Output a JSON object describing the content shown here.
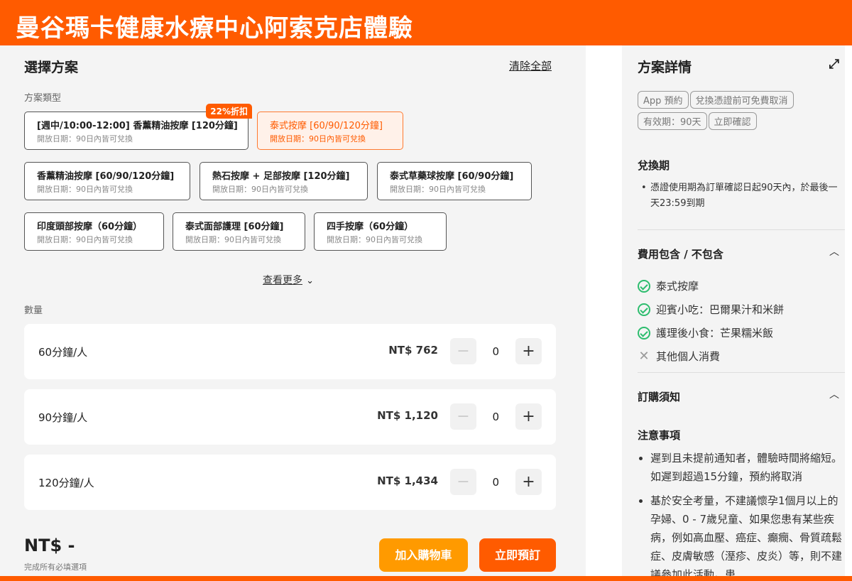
{
  "header": {
    "title": "曼谷瑪卡健康水療中心阿索克店體驗"
  },
  "select": {
    "title": "選擇方案",
    "clear_all": "清除全部",
    "type_label": "方案類型",
    "see_more": "查看更多",
    "qty_label": "數量"
  },
  "packages": [
    {
      "name": "[週中/10:00-12:00] 香薰精油按摩 [120分鐘]",
      "sub": "開放日期：90日內皆可兌換",
      "badge": "22%折扣",
      "selected": false
    },
    {
      "name": "泰式按摩 [60/90/120分鐘]",
      "sub": "開放日期：90日內皆可兌換",
      "selected": true
    },
    {
      "name": "香薰精油按摩 [60/90/120分鐘]",
      "sub": "開放日期：90日內皆可兌換",
      "selected": false
    },
    {
      "name": "熱石按摩 + 足部按摩 [120分鐘]",
      "sub": "開放日期：90日內皆可兌換",
      "selected": false
    },
    {
      "name": "泰式草藥球按摩 [60/90分鐘]",
      "sub": "開放日期：90日內皆可兌換",
      "selected": false
    },
    {
      "name": "印度頭部按摩（60分鐘）",
      "sub": "開放日期：90日內皆可兌換",
      "selected": false
    },
    {
      "name": "泰式面部護理 [60分鐘]",
      "sub": "開放日期：90日內皆可兌換",
      "selected": false
    },
    {
      "name": "四手按摩（60分鐘）",
      "sub": "開放日期：90日內皆可兌換",
      "selected": false
    }
  ],
  "quantities": [
    {
      "name": "60分鐘/人",
      "price": "NT$ 762",
      "value": "0"
    },
    {
      "name": "90分鐘/人",
      "price": "NT$ 1,120",
      "value": "0"
    },
    {
      "name": "120分鐘/人",
      "price": "NT$ 1,434",
      "value": "0"
    }
  ],
  "footer": {
    "total": "NT$ -",
    "hint": "完成所有必填選項",
    "add_to_cart": "加入購物車",
    "book_now": "立即預訂"
  },
  "details": {
    "title": "方案詳情",
    "tags": [
      "App 預約",
      "兌換憑證前可免費取消",
      "有效期：90天",
      "立即確認"
    ],
    "redeem_title": "兌換期",
    "redeem_text": "憑證使用期為訂單確認日起90天內，於最後一天23:59到期",
    "fee_title": "費用包含 / 不包含",
    "included": [
      "泰式按摩",
      "迎賓小吃：巴爾果汁和米餅",
      "護理後小食：芒果糯米飯"
    ],
    "excluded": [
      "其他個人消費"
    ],
    "notice_title": "訂購須知",
    "notes_title": "注意事項",
    "notes": [
      "遲到且未提前通知者，體驗時間將縮短。如遲到超過15分鐘，預約將取消",
      "基於安全考量，不建議懷孕1個月以上的孕婦、0 - 7歲兒童、如果您患有某些疾病，例如高血壓、癌症、癲癇、骨質疏鬆症、皮膚敏感（溼疹、皮炎）等，則不建議參加此活動。患"
    ]
  },
  "colors": {
    "brand": "#ff5b00",
    "check": "#2dbd6e",
    "cart": "#ff9a00"
  }
}
